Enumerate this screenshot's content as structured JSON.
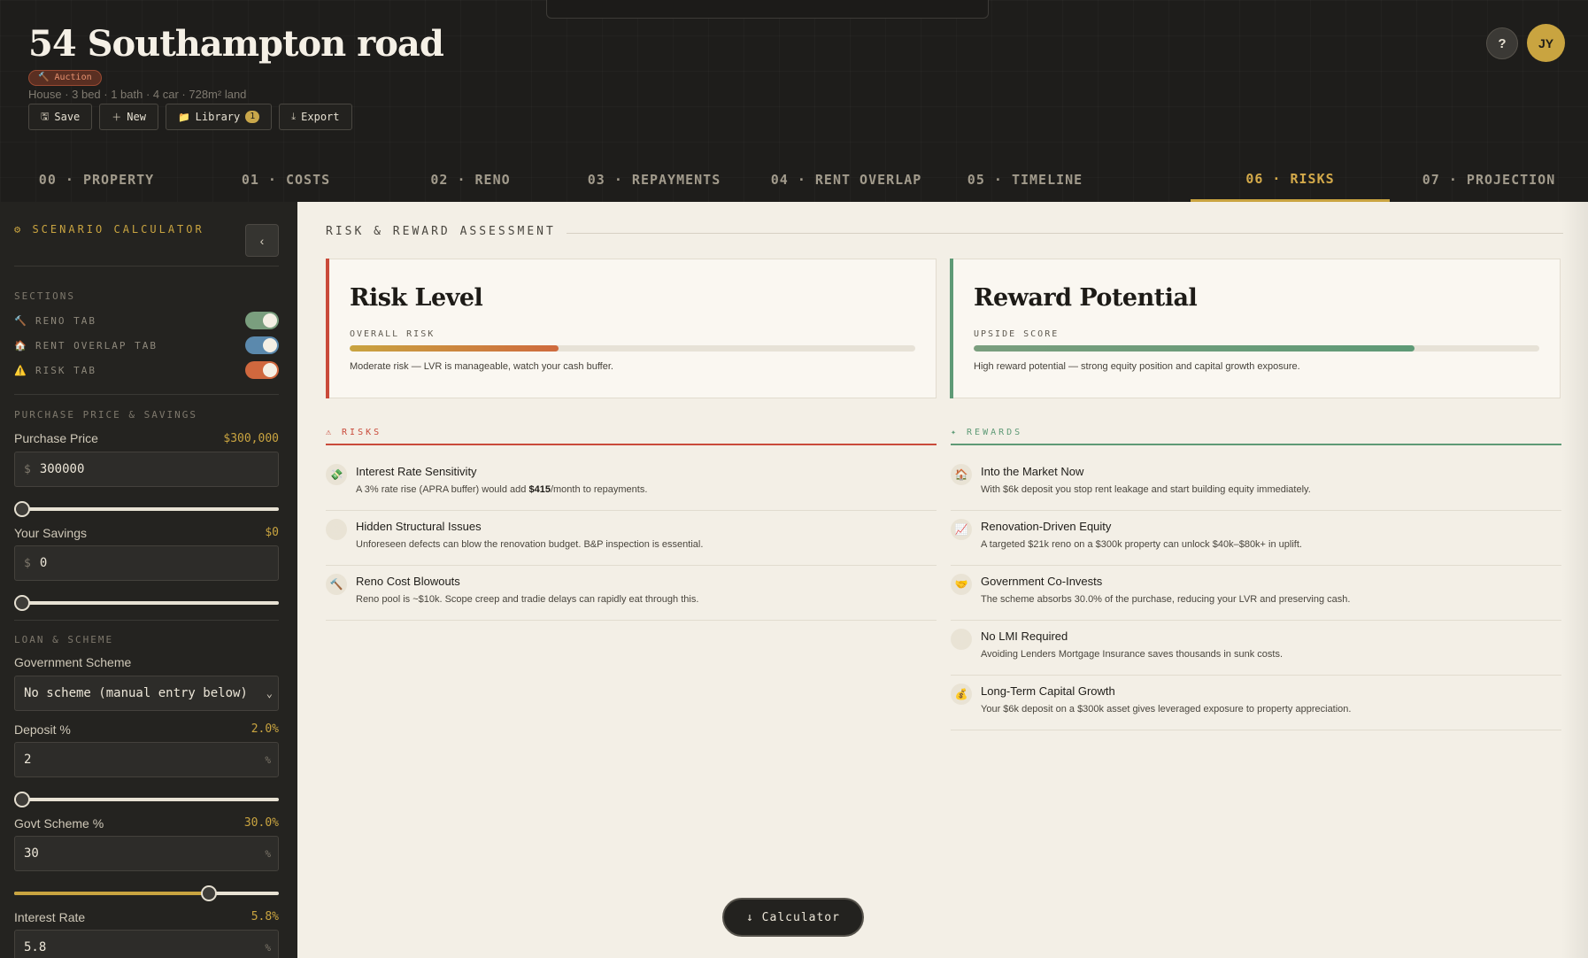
{
  "header": {
    "title": "54 Southampton road",
    "badge": "🔨 Auction",
    "meta": "House · 3 bed · 1 bath · 4 car · 728m² land",
    "actions": {
      "save": "Save",
      "new": "New",
      "library": "Library",
      "library_count": "1",
      "export": "Export"
    },
    "help": "?",
    "avatar": "JY"
  },
  "tabs": [
    {
      "label": "00 · PROPERTY"
    },
    {
      "label": "01 · COSTS"
    },
    {
      "label": "02 · RENO"
    },
    {
      "label": "03 · REPAYMENTS"
    },
    {
      "label": "04 · RENT OVERLAP"
    },
    {
      "label": "05 · TIMELINE"
    },
    {
      "label": "06 · RISKS",
      "active": true
    },
    {
      "label": "07 · PROJECTION"
    }
  ],
  "sidebar": {
    "heading": "⚙ SCENARIO CALCULATOR",
    "collapse": "‹",
    "sections_label": "SECTIONS",
    "toggles": [
      {
        "icon": "🔨",
        "label": "RENO TAB",
        "on": true,
        "color": "#7a9e7e"
      },
      {
        "icon": "🏠",
        "label": "RENT OVERLAP TAB",
        "on": true,
        "color": "#5b89ad"
      },
      {
        "icon": "⚠️",
        "label": "RISK TAB",
        "on": true,
        "color": "#d0683e"
      }
    ],
    "purchase_heading": "PURCHASE PRICE & SAVINGS",
    "purchase_price": {
      "label": "Purchase Price",
      "display": "$300,000",
      "prefix": "$",
      "value": "300000",
      "level": 0
    },
    "savings": {
      "label": "Your Savings",
      "display": "$0",
      "prefix": "$",
      "value": "0",
      "level": 0
    },
    "loan_heading": "LOAN & SCHEME",
    "scheme": {
      "label": "Government Scheme",
      "value": "No scheme (manual entry below)",
      "caret": "⌄"
    },
    "deposit": {
      "label": "Deposit %",
      "display": "2.0%",
      "value": "2",
      "suffix": "%",
      "level": 0
    },
    "govt": {
      "label": "Govt Scheme %",
      "display": "30.0%",
      "value": "30",
      "suffix": "%",
      "level": 0.75
    },
    "interest": {
      "label": "Interest Rate",
      "display": "5.8%",
      "value": "5.8",
      "suffix": "%"
    }
  },
  "main": {
    "section_title": "RISK & REWARD ASSESSMENT",
    "risk_card": {
      "title": "Risk Level",
      "meter_label": "OVERALL RISK",
      "level": 0.37,
      "desc": "Moderate risk — LVR is manageable, watch your cash buffer.",
      "accent": "#c94a3a"
    },
    "reward_card": {
      "title": "Reward Potential",
      "meter_label": "UPSIDE SCORE",
      "level": 0.78,
      "desc": "High reward potential — strong equity position and capital growth exposure.",
      "accent": "#5e9a76"
    },
    "risks_heading": "⚠ RISKS",
    "risks": [
      {
        "icon": "💸",
        "title": "Interest Rate Sensitivity",
        "desc_pre": "A 3% rate rise (APRA buffer) would add ",
        "desc_bold": "$415",
        "desc_post": "/month to repayments."
      },
      {
        "icon": "🏚",
        "title": "Hidden Structural Issues",
        "desc_pre": "Unforeseen defects can blow the renovation budget. B&P inspection is essential.",
        "desc_bold": "",
        "desc_post": ""
      },
      {
        "icon": "🔨",
        "title": "Reno Cost Blowouts",
        "desc_pre": "Reno pool is ~$10k. Scope creep and tradie delays can rapidly eat through this.",
        "desc_bold": "",
        "desc_post": ""
      }
    ],
    "rewards_heading": "✦ REWARDS",
    "rewards": [
      {
        "icon": "🏠",
        "title": "Into the Market Now",
        "desc": "With $6k deposit you stop rent leakage and start building equity immediately."
      },
      {
        "icon": "📈",
        "title": "Renovation-Driven Equity",
        "desc": "A targeted $21k reno on a $300k property can unlock $40k–$80k+ in uplift."
      },
      {
        "icon": "🤝",
        "title": "Government Co-Invests",
        "desc": "The scheme absorbs 30.0% of the purchase, reducing your LVR and preserving cash."
      },
      {
        "icon": "🛡",
        "title": "No LMI Required",
        "desc": "Avoiding Lenders Mortgage Insurance saves thousands in sunk costs."
      },
      {
        "icon": "💰",
        "title": "Long-Term Capital Growth",
        "desc": "Your $6k deposit on a $300k asset gives leveraged exposure to property appreciation."
      }
    ]
  },
  "calculator_button": "↓ Calculator"
}
